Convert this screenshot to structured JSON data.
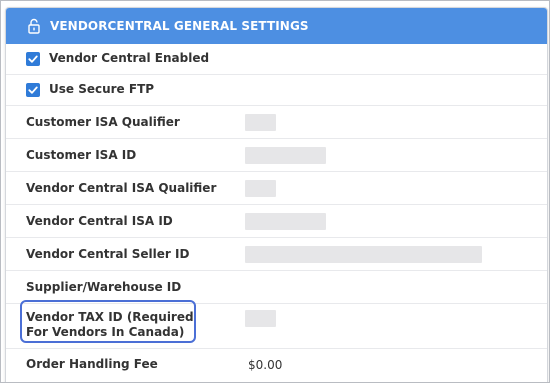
{
  "panel": {
    "title": "VENDORCENTRAL GENERAL SETTINGS",
    "header_color": "#4d8fe2",
    "header_icon": "unlock-icon"
  },
  "checkboxes": [
    {
      "label": "Vendor Central Enabled",
      "checked": true
    },
    {
      "label": "Use Secure FTP",
      "checked": true
    }
  ],
  "fields": {
    "customer_isa_qualifier": {
      "label": "Customer ISA Qualifier"
    },
    "customer_isa_id": {
      "label": "Customer ISA ID"
    },
    "vendor_central_isa_qualifier": {
      "label": "Vendor Central ISA Qualifier"
    },
    "vendor_central_isa_id": {
      "label": "Vendor Central ISA ID"
    },
    "vendor_central_seller_id": {
      "label": "Vendor Central Seller ID"
    },
    "supplier_warehouse_id": {
      "label": "Supplier/Warehouse ID"
    },
    "vendor_tax_id": {
      "label": "Vendor TAX ID (Required For Vendors In Canada)"
    },
    "order_handling_fee": {
      "label": "Order Handling Fee",
      "value": "$0.00"
    }
  },
  "accent_colors": {
    "checkbox": "#2f7bd8",
    "highlight": "#4b6fd6"
  }
}
